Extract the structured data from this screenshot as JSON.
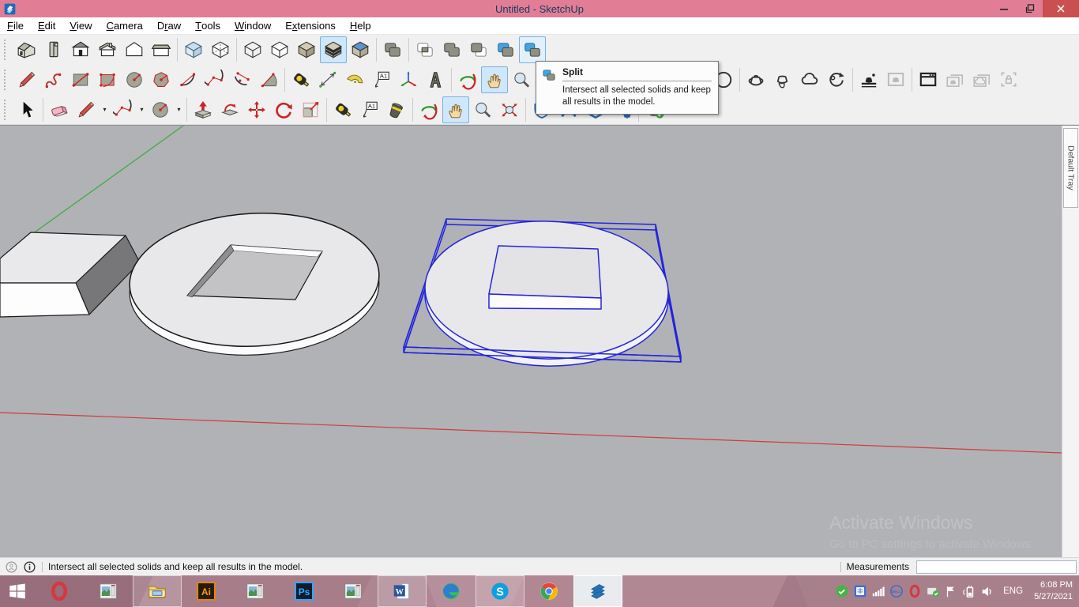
{
  "titlebar": {
    "title": "Untitled - SketchUp"
  },
  "menubar": {
    "items": [
      {
        "label": "File",
        "mnemonic": 0
      },
      {
        "label": "Edit",
        "mnemonic": 0
      },
      {
        "label": "View",
        "mnemonic": 0
      },
      {
        "label": "Camera",
        "mnemonic": 0
      },
      {
        "label": "Draw",
        "mnemonic": 1
      },
      {
        "label": "Tools",
        "mnemonic": 0
      },
      {
        "label": "Window",
        "mnemonic": 0
      },
      {
        "label": "Extensions",
        "mnemonic": 1
      },
      {
        "label": "Help",
        "mnemonic": 0
      }
    ]
  },
  "toolbars": {
    "row1": [
      {
        "icons": [
          {
            "n": "view-iso"
          },
          {
            "n": "view-top"
          },
          {
            "n": "view-front"
          },
          {
            "n": "view-right"
          },
          {
            "n": "view-back"
          },
          {
            "n": "view-left"
          }
        ]
      },
      {
        "icons": [
          {
            "n": "style-xray"
          },
          {
            "n": "style-back-edges"
          }
        ]
      },
      {
        "icons": [
          {
            "n": "style-wireframe"
          },
          {
            "n": "style-hidden-line"
          },
          {
            "n": "style-shaded"
          },
          {
            "n": "style-textured",
            "s": "active"
          },
          {
            "n": "style-monochrome"
          }
        ]
      },
      {
        "icons": [
          {
            "n": "solid-outer-shell"
          }
        ]
      },
      {
        "icons": [
          {
            "n": "solid-intersect"
          },
          {
            "n": "solid-union"
          },
          {
            "n": "solid-subtract"
          },
          {
            "n": "solid-trim"
          },
          {
            "n": "solid-split",
            "s": "hover"
          }
        ]
      }
    ],
    "row2": [
      {
        "icons": [
          {
            "n": "tool-line"
          },
          {
            "n": "tool-freehand"
          },
          {
            "n": "tool-rectangle"
          },
          {
            "n": "tool-rotated-rectangle"
          },
          {
            "n": "tool-circle"
          },
          {
            "n": "tool-polygon"
          },
          {
            "n": "tool-arc"
          },
          {
            "n": "tool-2pt-arc"
          },
          {
            "n": "tool-3pt-arc"
          },
          {
            "n": "tool-pie"
          }
        ]
      },
      {
        "icons": [
          {
            "n": "tool-tape"
          },
          {
            "n": "tool-dimension"
          },
          {
            "n": "tool-protractor"
          },
          {
            "n": "tool-text"
          },
          {
            "n": "tool-axes"
          },
          {
            "n": "tool-3d-text"
          }
        ]
      },
      {
        "icons": [
          {
            "n": "tool-orbit"
          },
          {
            "n": "tool-pan",
            "s": "active"
          },
          {
            "n": "tool-zoom"
          }
        ]
      },
      {
        "spacer": 222
      },
      {
        "icons": [
          {
            "n": "camera-look"
          }
        ]
      },
      {
        "icons": [
          {
            "n": "warehouse-get-models"
          },
          {
            "n": "warehouse-share-model"
          },
          {
            "n": "warehouse-cloud"
          },
          {
            "n": "warehouse-sync"
          }
        ]
      },
      {
        "icons": [
          {
            "n": "layout-send"
          },
          {
            "n": "layout-frame",
            "s": "disabled"
          }
        ]
      },
      {
        "icons": [
          {
            "n": "window-new"
          },
          {
            "n": "frames-model",
            "s": "disabled"
          },
          {
            "n": "frames-cloud",
            "s": "disabled"
          },
          {
            "n": "frame-lock",
            "s": "disabled"
          }
        ]
      }
    ],
    "row3": [
      {
        "icons": [
          {
            "n": "tool-select"
          }
        ]
      },
      {
        "icons": [
          {
            "n": "tool-eraser"
          },
          {
            "n": "tool-line",
            "dd": true
          },
          {
            "n": "tool-2pt-arc",
            "dd": true
          },
          {
            "n": "tool-circle",
            "dd": true
          }
        ]
      },
      {
        "icons": [
          {
            "n": "tool-pushpull"
          },
          {
            "n": "tool-followme"
          },
          {
            "n": "tool-move"
          },
          {
            "n": "tool-rotate"
          },
          {
            "n": "tool-scale"
          }
        ]
      },
      {
        "icons": [
          {
            "n": "tool-tape"
          },
          {
            "n": "tool-text"
          },
          {
            "n": "tool-paint"
          }
        ]
      },
      {
        "icons": [
          {
            "n": "tool-orbit"
          },
          {
            "n": "tool-pan",
            "s": "active"
          },
          {
            "n": "tool-zoom"
          },
          {
            "n": "tool-zoom-extents"
          }
        ]
      },
      {
        "icons": [
          {
            "n": "ext-shield"
          },
          {
            "n": "ext-x"
          },
          {
            "n": "ext-layers"
          },
          {
            "n": "ext-gear"
          }
        ]
      },
      {
        "icons": [
          {
            "n": "account",
            "dd": true
          }
        ]
      }
    ]
  },
  "tooltip": {
    "title": "Split",
    "description": "Intersect all selected solids and keep all results in the model."
  },
  "viewport": {
    "tray_label": "Default Tray",
    "watermark_line1": "Activate Windows",
    "watermark_line2": "Go to PC settings to activate Windows."
  },
  "statusbar": {
    "message": "Intersect all selected solids and keep all results in the model.",
    "measurements_label": "Measurements",
    "measurements_value": ""
  },
  "taskbar": {
    "apps": [
      {
        "n": "start"
      },
      {
        "n": "opera"
      },
      {
        "n": "app-window"
      },
      {
        "n": "explorer",
        "s": "open"
      },
      {
        "n": "illustrator"
      },
      {
        "n": "app-window"
      },
      {
        "n": "photoshop"
      },
      {
        "n": "app-window"
      },
      {
        "n": "word",
        "s": "open"
      },
      {
        "n": "edge"
      },
      {
        "n": "skype",
        "s": "open"
      },
      {
        "n": "chrome"
      },
      {
        "n": "sketchup",
        "s": "active"
      }
    ],
    "tray": [
      {
        "n": "check-green"
      },
      {
        "n": "ime"
      },
      {
        "n": "signal"
      },
      {
        "n": "dell"
      },
      {
        "n": "opera-mini"
      },
      {
        "n": "card-check"
      },
      {
        "n": "flag"
      },
      {
        "n": "battery"
      },
      {
        "n": "speaker"
      }
    ],
    "language": "ENG",
    "time": "6:08 PM",
    "date": "5/27/2021"
  },
  "colors": {
    "titlebar": "#e17e96",
    "close_button": "#c9504e",
    "viewport_bg": "#b0b2b6",
    "selection_blue": "#2323dd",
    "axis_green": "#3fae3f",
    "axis_red": "#d23b3b",
    "highlight": "#cfe7fa",
    "taskbar": "#b18794"
  }
}
